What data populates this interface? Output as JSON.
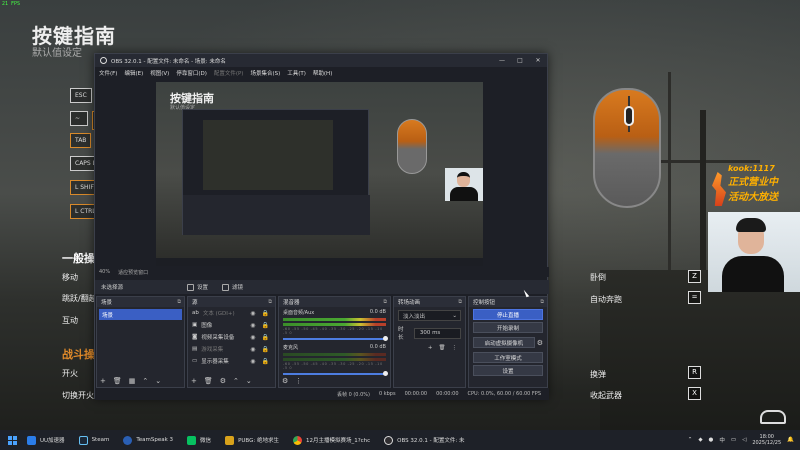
{
  "fps_overlay": "21 FPS",
  "game": {
    "title": "按键指南",
    "subtitle": "默认值设定",
    "keys": [
      "ESC",
      "~",
      "TAB",
      "CAPS LK",
      "L SHIFT",
      "L CTRL"
    ],
    "sections": {
      "general": "一般操",
      "combat": "战斗操"
    },
    "left_labels": [
      "移动",
      "跳跃/翻越",
      "互动",
      "开火",
      "切换开火模"
    ],
    "right_labels": [
      {
        "label": "卧倒",
        "key": "Z"
      },
      {
        "label": "自动奔跑",
        "key": "="
      },
      {
        "label": "换弹",
        "key": "R"
      },
      {
        "label": "收起武器",
        "key": "X"
      }
    ],
    "promo_line1": "kook:1117",
    "promo_line2": "正式营业中",
    "promo_line3": "活动大放送"
  },
  "obs": {
    "title": "OBS 32.0.1 - 配置文件: 未命名 - 场景: 未命名",
    "window_controls": [
      "—",
      "□",
      "✕"
    ],
    "menu": [
      "文件(F)",
      "编辑(E)",
      "视图(V)",
      "停靠窗口(D)",
      "配置文件(P)",
      "场景集合(S)",
      "工具(T)",
      "帮助(H)"
    ],
    "preview": {
      "title": "按键指南",
      "subtitle": "默认值设定"
    },
    "preview_status": {
      "zoom": "40%",
      "fit": "适应预览窗口"
    },
    "scene_bar": {
      "no_source": "未选择源",
      "properties": "设置",
      "filters": "滤镜"
    },
    "scenes": {
      "header": "场景",
      "items": [
        "场景"
      ]
    },
    "sources": {
      "header": "源",
      "items": [
        {
          "name": "文本 (GDI+)",
          "dim": true
        },
        {
          "name": "图像",
          "dim": false
        },
        {
          "name": "视频采集设备",
          "dim": false
        },
        {
          "name": "游戏采集",
          "dim": true
        },
        {
          "name": "显示器采集",
          "dim": false
        }
      ]
    },
    "mixer": {
      "header": "混音器",
      "channels": [
        {
          "name": "桌面音频/Aux",
          "db": "0.0 dB",
          "level": 0.85
        },
        {
          "name": "麦克风",
          "db": "0.0 dB",
          "level": 0.2
        }
      ],
      "ticks": "-60 -55 -50 -45 -40 -35 -30 -25 -20 -15 -10 -5 0"
    },
    "transitions": {
      "header": "转场动画",
      "selected": "淡入淡出",
      "duration_label": "时长",
      "duration": "300 ms"
    },
    "controls": {
      "header": "控制按钮",
      "buttons": [
        "停止直播",
        "开始录制",
        "启动虚拟摄像机",
        "工作室模式",
        "设置"
      ]
    },
    "status": {
      "dropped": "丢帧 0 (0.0%)",
      "bitrate": "0 kbps",
      "live_time": "00:00:00",
      "rec_time": "00:00:00",
      "cpu": "CPU: 0.0%, 60.00 / 60.00 FPS"
    }
  },
  "taskbar": {
    "apps": [
      "UU加速器",
      "Steam",
      "TeamSpeak 3",
      "微信",
      "PUBG: 绝地求生",
      "12月主播模拟赛场_1?chc",
      "OBS 32.0.1 - 配置文件: 未"
    ],
    "ime": "中",
    "time": "18:00",
    "date": "2025/12/25"
  }
}
